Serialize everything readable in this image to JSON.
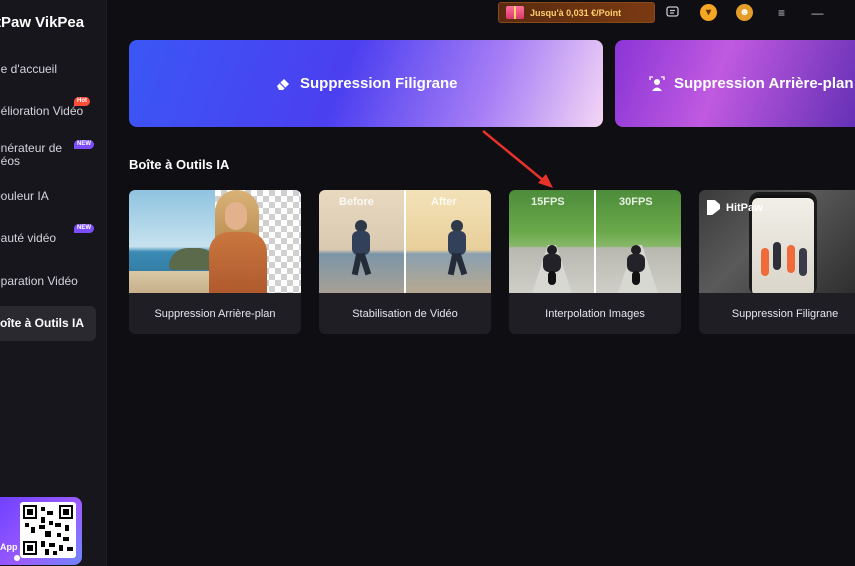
{
  "app": {
    "title": "tPaw VikPea"
  },
  "sidebar": {
    "items": [
      {
        "label": "ge d'accueil"
      },
      {
        "label": "nélioration Vidéo",
        "badge": "Hot"
      },
      {
        "label_line1": "énérateur de",
        "label_line2": "déos",
        "badge": "NEW"
      },
      {
        "label": "bouleur IA"
      },
      {
        "label": "eauté vidéo",
        "badge": "NEW"
      },
      {
        "label": "éparation Vidéo"
      },
      {
        "label": "oîte à Outils IA"
      }
    ],
    "qr_card": {
      "label": "App"
    }
  },
  "topbar": {
    "promo_text": "Jusqu'à 0,031 €/Point"
  },
  "banners": [
    {
      "title": "Suppression Filigrane",
      "icon": "eraser-icon"
    },
    {
      "title": "Suppression Arrière-plan",
      "icon": "person-scan-icon"
    }
  ],
  "toolbox": {
    "title": "Boîte à Outils IA",
    "cards": [
      {
        "label": "Suppression Arrière-plan"
      },
      {
        "label": "Stabilisation de Vidéo",
        "tags": [
          "Before",
          "After"
        ]
      },
      {
        "label": "Interpolation Images",
        "tags": [
          "15FPS",
          "30FPS"
        ]
      },
      {
        "label": "Suppression Filigrane",
        "brand": "HitPaw"
      }
    ]
  },
  "colors": {
    "background": "#0f0e13",
    "sidebar": "#17161c",
    "card": "#1f1e25",
    "accent_purple": "#7b4dff",
    "hot_badge": "#ff4d3a",
    "annotation_arrow": "#e8322c"
  }
}
